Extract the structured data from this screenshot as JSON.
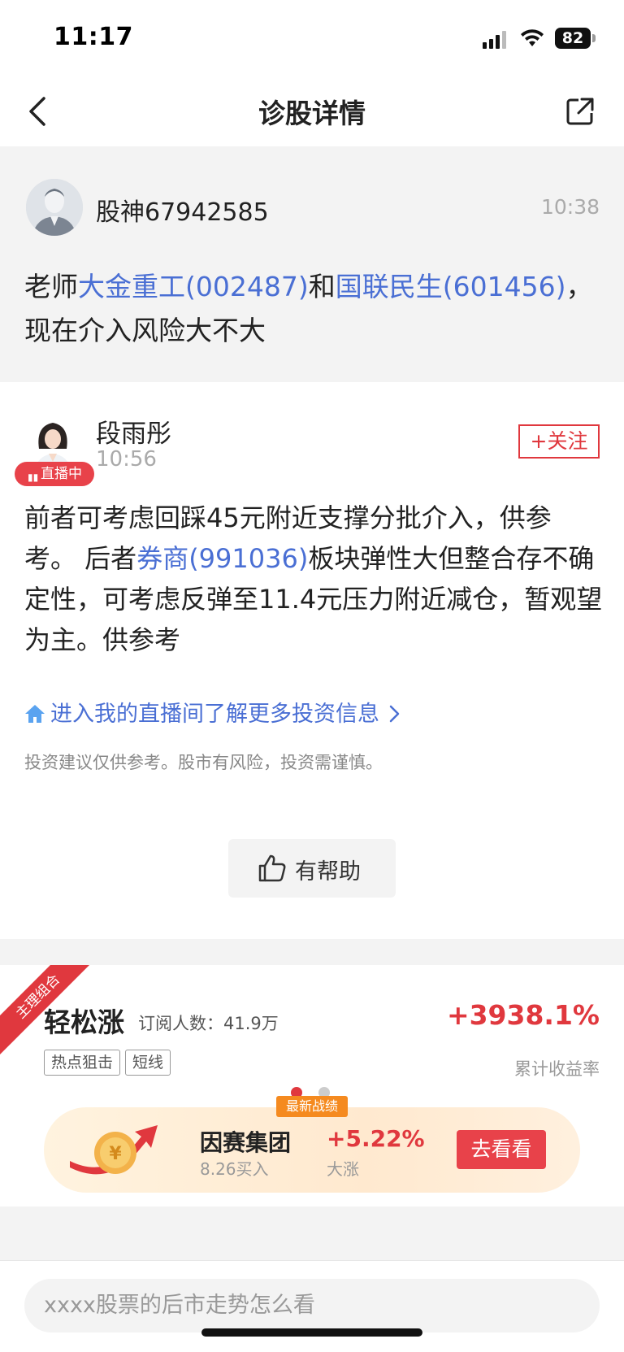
{
  "status_bar": {
    "time": "11:17",
    "battery": "82"
  },
  "nav": {
    "title": "诊股详情"
  },
  "question": {
    "user": "股神67942585",
    "time": "10:38",
    "parts": [
      {
        "text": "老师",
        "link": false
      },
      {
        "text": "大金重工(002487)",
        "link": true
      },
      {
        "text": "和",
        "link": false
      },
      {
        "text": "国联民生(601456)",
        "link": true
      },
      {
        "text": "，现在介入风险大不大",
        "link": false
      }
    ]
  },
  "answer": {
    "name": "段雨彤",
    "time": "10:56",
    "live_badge": "直播中",
    "follow_label": "+关注",
    "parts": [
      {
        "text": "前者可考虑回踩45元附近支撑分批介入，供参考。 后者",
        "link": false
      },
      {
        "text": "券商(991036)",
        "link": true
      },
      {
        "text": "板块弹性大但整合存不确定性，可考虑反弹至11.4元压力附近减仓，暂观望为主。供参考",
        "link": false
      }
    ],
    "live_link": "进入我的直播间了解更多投资信息",
    "disclaimer": "投资建议仅供参考。股市有风险，投资需谨慎。",
    "helpful_label": "有帮助"
  },
  "portfolio": {
    "ribbon": "主理组合",
    "name": "轻松涨",
    "subscribers": "订阅人数：41.9万",
    "return_rate": "+3938.1%",
    "return_label": "累计收益率",
    "tags": [
      "热点狙击",
      "短线"
    ],
    "promo": {
      "badge": "最新战绩",
      "stock": "因赛集团",
      "buy_info": "8.26买入",
      "change": "+5.22%",
      "change_label": "大涨",
      "button": "去看看"
    }
  },
  "search": {
    "placeholder": "xxxx股票的后市走势怎么看"
  },
  "colors": {
    "accent_red": "#e0383e",
    "link_blue": "#4a6fd4",
    "bg_gray": "#f3f3f3"
  }
}
